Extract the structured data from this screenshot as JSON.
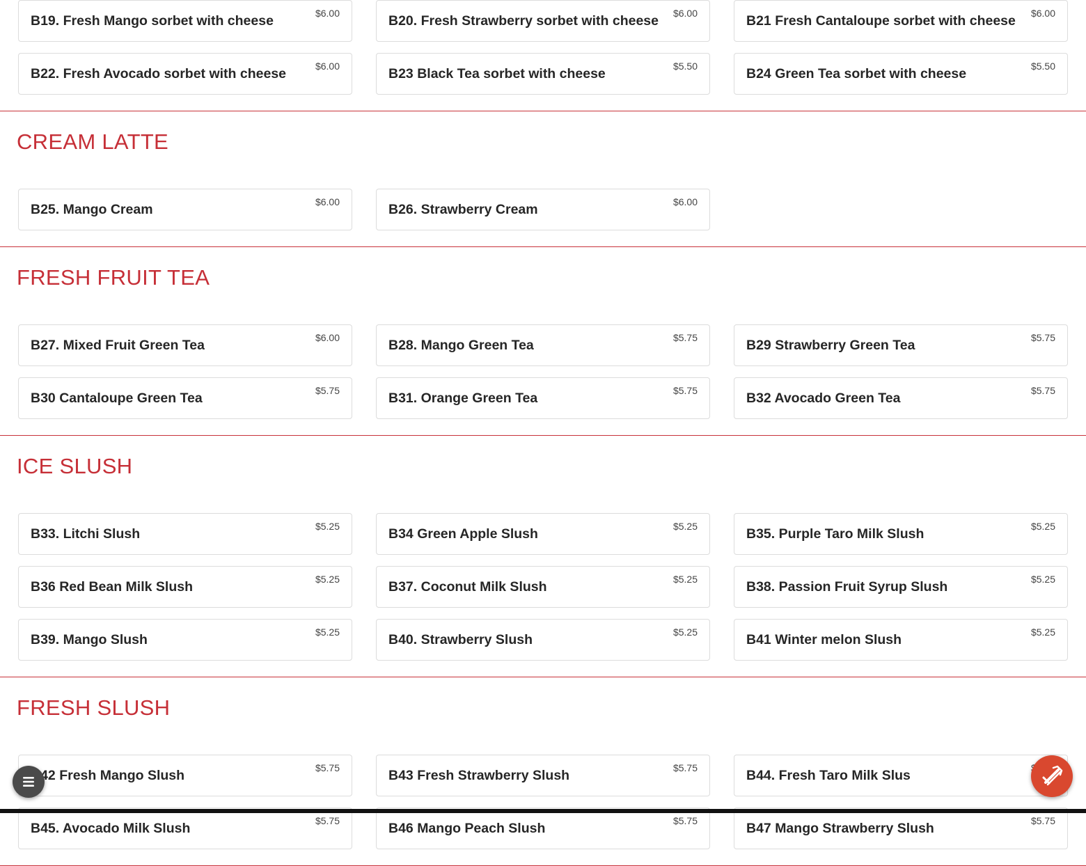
{
  "sections": [
    {
      "title": "",
      "items": [
        {
          "name": "B19. Fresh Mango sorbet with cheese",
          "price": "$6.00"
        },
        {
          "name": "B20. Fresh Strawberry sorbet with cheese",
          "price": "$6.00"
        },
        {
          "name": "B21 Fresh Cantaloupe sorbet with cheese",
          "price": "$6.00"
        },
        {
          "name": "B22. Fresh Avocado sorbet with cheese",
          "price": "$6.00"
        },
        {
          "name": "B23 Black Tea sorbet with cheese",
          "price": "$5.50"
        },
        {
          "name": "B24 Green Tea sorbet with cheese",
          "price": "$5.50"
        }
      ]
    },
    {
      "title": "CREAM LATTE",
      "items": [
        {
          "name": "B25. Mango Cream",
          "price": "$6.00"
        },
        {
          "name": "B26. Strawberry Cream",
          "price": "$6.00"
        }
      ]
    },
    {
      "title": "FRESH FRUIT TEA",
      "items": [
        {
          "name": "B27. Mixed Fruit Green Tea",
          "price": "$6.00"
        },
        {
          "name": "B28. Mango Green Tea",
          "price": "$5.75"
        },
        {
          "name": "B29 Strawberry Green Tea",
          "price": "$5.75"
        },
        {
          "name": "B30 Cantaloupe Green Tea",
          "price": "$5.75"
        },
        {
          "name": "B31. Orange Green Tea",
          "price": "$5.75"
        },
        {
          "name": "B32 Avocado Green Tea",
          "price": "$5.75"
        }
      ]
    },
    {
      "title": "ICE SLUSH",
      "items": [
        {
          "name": "B33. Litchi Slush",
          "price": "$5.25"
        },
        {
          "name": "B34 Green Apple Slush",
          "price": "$5.25"
        },
        {
          "name": "B35. Purple Taro Milk Slush",
          "price": "$5.25"
        },
        {
          "name": "B36 Red Bean Milk Slush",
          "price": "$5.25"
        },
        {
          "name": "B37. Coconut Milk Slush",
          "price": "$5.25"
        },
        {
          "name": "B38. Passion Fruit Syrup Slush",
          "price": "$5.25"
        },
        {
          "name": "B39. Mango Slush",
          "price": "$5.25"
        },
        {
          "name": "B40. Strawberry Slush",
          "price": "$5.25"
        },
        {
          "name": "B41 Winter melon Slush",
          "price": "$5.25"
        }
      ]
    },
    {
      "title": "FRESH SLUSH",
      "items": [
        {
          "name": "B42 Fresh Mango Slush",
          "price": "$5.75"
        },
        {
          "name": "B43 Fresh Strawberry Slush",
          "price": "$5.75"
        },
        {
          "name": "B44. Fresh Taro Milk Slus",
          "price": "$5.75"
        },
        {
          "name": "B45. Avocado Milk Slush",
          "price": "$5.75"
        },
        {
          "name": "B46 Mango Peach Slush",
          "price": "$5.75"
        },
        {
          "name": "B47 Mango Strawberry Slush",
          "price": "$5.75"
        }
      ]
    }
  ],
  "floating_buttons": {
    "menu_icon": "list-icon",
    "order_icon": "order-online-icon"
  },
  "colors": {
    "accent": "#c62f37",
    "order_button": "#d9482f",
    "menu_button": "#4a4a4a"
  }
}
